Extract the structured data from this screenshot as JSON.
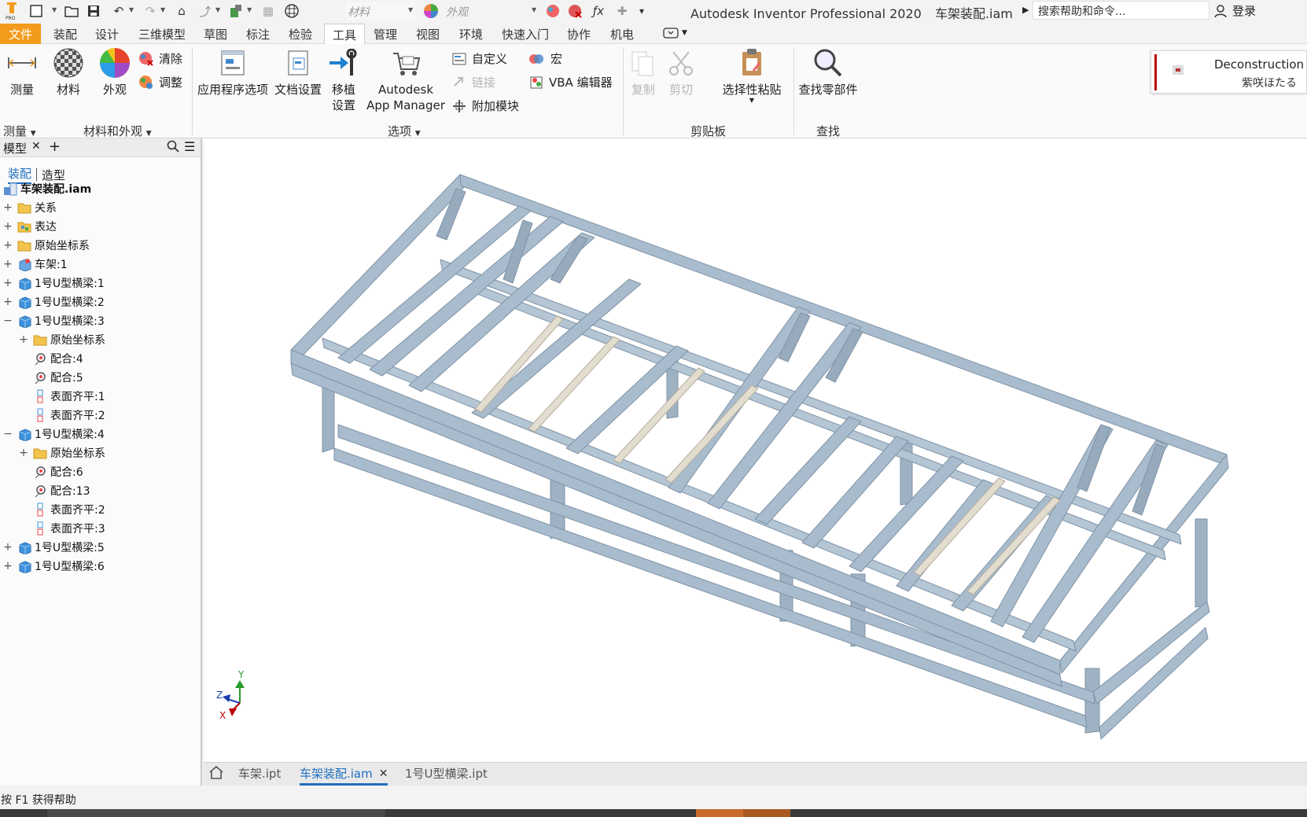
{
  "titlebar": {
    "material_placeholder": "材料",
    "appearance_placeholder": "外观",
    "app_title": "Autodesk Inventor Professional 2020",
    "file_name": "车架装配.iam",
    "help_search_placeholder": "搜索帮助和命令...",
    "login_label": "登录"
  },
  "ribbon_tabs": [
    {
      "label": "文件"
    },
    {
      "label": "装配"
    },
    {
      "label": "设计"
    },
    {
      "label": "三维模型"
    },
    {
      "label": "草图"
    },
    {
      "label": "标注"
    },
    {
      "label": "检验"
    },
    {
      "label": "工具"
    },
    {
      "label": "管理"
    },
    {
      "label": "视图"
    },
    {
      "label": "环境"
    },
    {
      "label": "快速入门"
    },
    {
      "label": "协作"
    },
    {
      "label": "机电"
    }
  ],
  "ribbon": {
    "measure": "测量",
    "material": "材料",
    "appearance": "外观",
    "clear": "清除",
    "adjust": "调整",
    "app_options": "应用程序选项",
    "doc_settings": "文档设置",
    "migrate_line1": "移植",
    "migrate_line2": "设置",
    "autodesk_line1": "Autodesk",
    "autodesk_line2": "App Manager",
    "customize": "自定义",
    "link": "链接",
    "addins": "附加模块",
    "macro": "宏",
    "vba": "VBA 编辑器",
    "copy": "复制",
    "cut": "剪切",
    "paste_special": "选择性粘贴",
    "find_component": "查找零部件",
    "group_measure": "测量",
    "group_material": "材料和外观",
    "group_options": "选项",
    "group_clipboard": "剪贴板",
    "group_find": "查找"
  },
  "notice": {
    "title": "Deconstruction S",
    "subtitle": "紫咲ほたる"
  },
  "browser": {
    "title": "模型",
    "view_assembly": "装配",
    "view_modeling": "造型",
    "root": "车架装配.iam",
    "nodes": [
      {
        "label": "关系"
      },
      {
        "label": "表达"
      },
      {
        "label": "原始坐标系"
      },
      {
        "label": "车架:1"
      },
      {
        "label": "1号U型横梁:1"
      },
      {
        "label": "1号U型横梁:2"
      },
      {
        "label": "1号U型横梁:3"
      },
      {
        "label": "原始坐标系"
      },
      {
        "label": "配合:4"
      },
      {
        "label": "配合:5"
      },
      {
        "label": "表面齐平:1"
      },
      {
        "label": "表面齐平:2"
      },
      {
        "label": "1号U型横梁:4"
      },
      {
        "label": "原始坐标系"
      },
      {
        "label": "配合:6"
      },
      {
        "label": "配合:13"
      },
      {
        "label": "表面齐平:2"
      },
      {
        "label": "表面齐平:3"
      },
      {
        "label": "1号U型横梁:5"
      },
      {
        "label": "1号U型横梁:6"
      }
    ]
  },
  "axis_labels": {
    "x": "X",
    "y": "Y",
    "z": "Z"
  },
  "doc_tabs": [
    {
      "label": "车架.ipt"
    },
    {
      "label": "车架装配.iam"
    },
    {
      "label": "1号U型横梁.ipt"
    }
  ],
  "status": "按 F1 获得帮助",
  "colors": {
    "file_tab": "#f29b1d",
    "accent": "#1f6fc0",
    "frame_beam": "#a9bccd",
    "crossbar": "#e3ddd0"
  }
}
